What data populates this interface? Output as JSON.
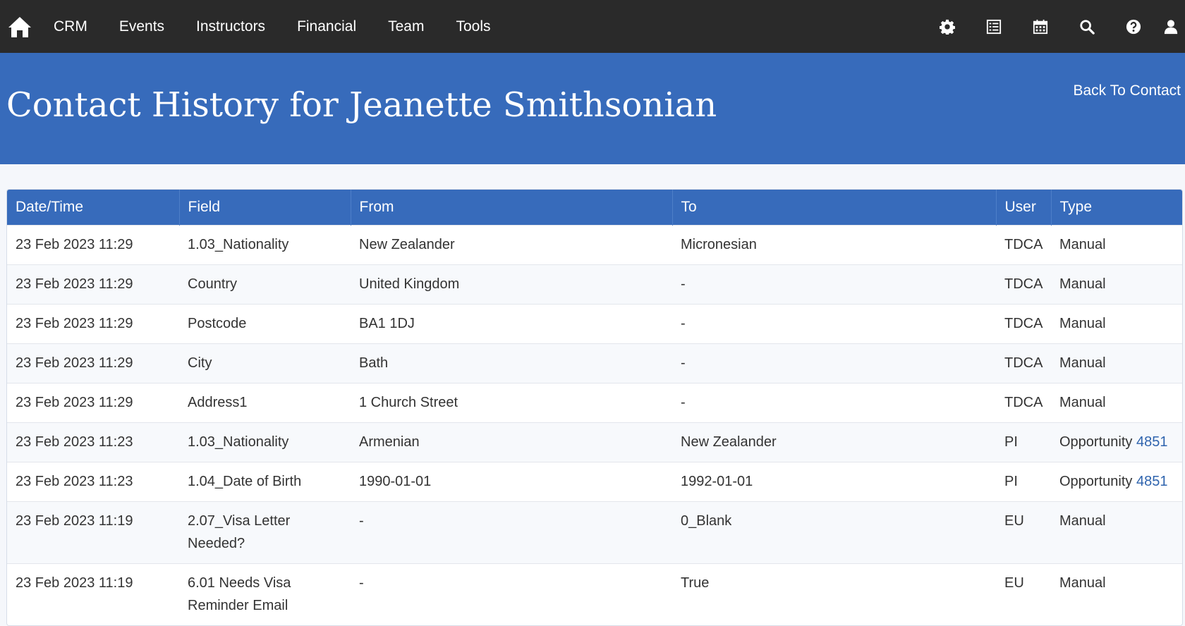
{
  "nav": {
    "items": [
      "CRM",
      "Events",
      "Instructors",
      "Financial",
      "Team",
      "Tools"
    ],
    "icons": [
      "home-icon",
      "gear-icon",
      "list-icon",
      "calendar-icon",
      "search-icon",
      "help-icon",
      "user-icon"
    ]
  },
  "header": {
    "title": "Contact History for Jeanette Smithsonian",
    "back_link": "Back To Contact",
    "bg_color": "#376bbb"
  },
  "table": {
    "columns": [
      "Date/Time",
      "Field",
      "From",
      "To",
      "User",
      "Type"
    ],
    "rows": [
      {
        "datetime": "23 Feb 2023 11:29",
        "field": "1.03_Nationality",
        "from": "New Zealander",
        "to": "Micronesian",
        "user": "TDCA",
        "type": "Manual",
        "link": ""
      },
      {
        "datetime": "23 Feb 2023 11:29",
        "field": "Country",
        "from": "United Kingdom",
        "to": "-",
        "user": "TDCA",
        "type": "Manual",
        "link": ""
      },
      {
        "datetime": "23 Feb 2023 11:29",
        "field": "Postcode",
        "from": "BA1 1DJ",
        "to": "-",
        "user": "TDCA",
        "type": "Manual",
        "link": ""
      },
      {
        "datetime": "23 Feb 2023 11:29",
        "field": "City",
        "from": "Bath",
        "to": "-",
        "user": "TDCA",
        "type": "Manual",
        "link": ""
      },
      {
        "datetime": "23 Feb 2023 11:29",
        "field": "Address1",
        "from": "1 Church Street",
        "to": "-",
        "user": "TDCA",
        "type": "Manual",
        "link": ""
      },
      {
        "datetime": "23 Feb 2023 11:23",
        "field": "1.03_Nationality",
        "from": "Armenian",
        "to": "New Zealander",
        "user": "PI",
        "type": "Opportunity",
        "link": "4851"
      },
      {
        "datetime": "23 Feb 2023 11:23",
        "field": "1.04_Date of Birth",
        "from": "1990-01-01",
        "to": "1992-01-01",
        "user": "PI",
        "type": "Opportunity",
        "link": "4851"
      },
      {
        "datetime": "23 Feb 2023 11:19",
        "field": "2.07_Visa Letter Needed?",
        "from": "-",
        "to": "0_Blank",
        "user": "EU",
        "type": "Manual",
        "link": ""
      },
      {
        "datetime": "23 Feb 2023 11:19",
        "field": "6.01 Needs Visa Reminder Email",
        "from": "-",
        "to": "True",
        "user": "EU",
        "type": "Manual",
        "link": ""
      }
    ]
  }
}
